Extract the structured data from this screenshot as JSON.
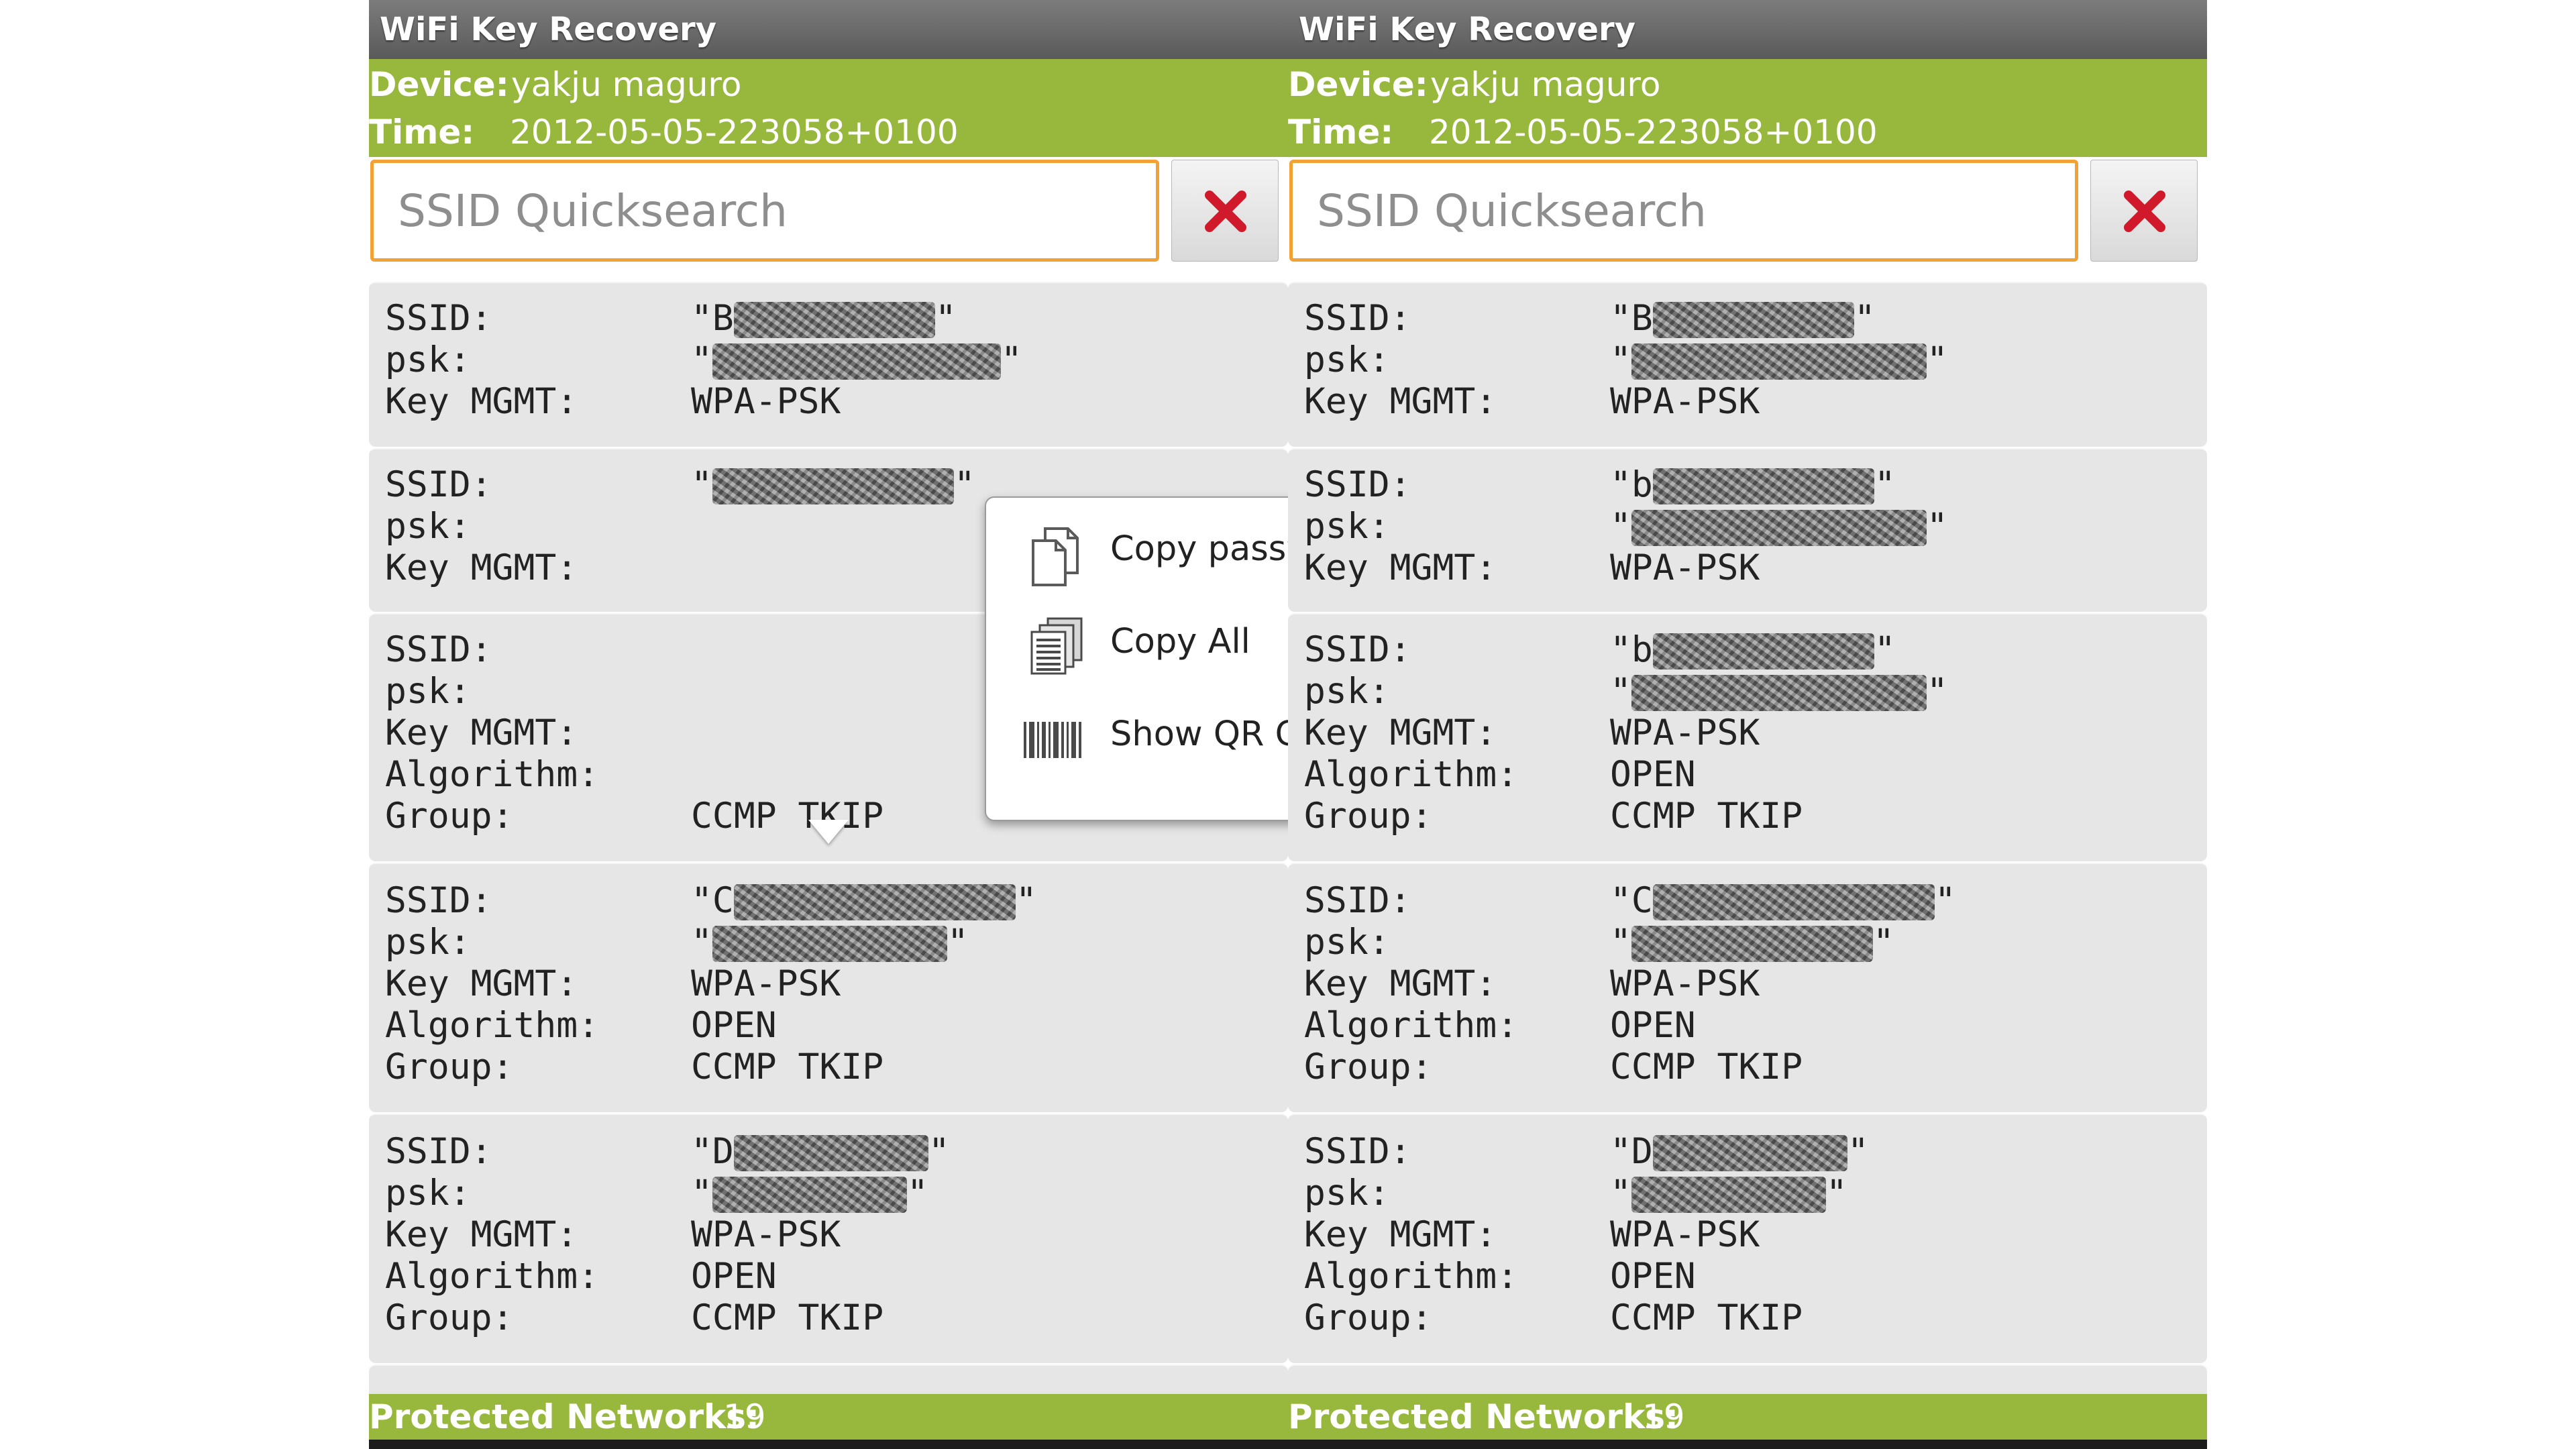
{
  "app": {
    "title": "WiFi Key Recovery"
  },
  "device": {
    "label": "Device:",
    "value": "yakju maguro"
  },
  "time": {
    "label": "Time:",
    "value": "2012-05-05-223058+0100"
  },
  "search": {
    "placeholder": "SSID Quicksearch",
    "clear_icon": "close-x-icon",
    "clear_color": "#d01a2b"
  },
  "labels": {
    "ssid": "SSID:",
    "psk": "psk:",
    "key_mgmt": "Key MGMT:",
    "algorithm": "Algorithm:",
    "group": "Group:",
    "quote": "\""
  },
  "left_networks": [
    {
      "ssid_prefix": "\"B",
      "key_mgmt": "WPA-PSK"
    },
    {
      "ssid_prefix": "\"",
      "key_mgmt": ""
    },
    {
      "ssid_prefix": "",
      "key_mgmt": "",
      "group": "CCMP TKIP"
    },
    {
      "ssid_prefix": "\"C",
      "key_mgmt": "WPA-PSK",
      "algorithm": "OPEN",
      "group": "CCMP TKIP"
    },
    {
      "ssid_prefix": "\"D",
      "key_mgmt": "WPA-PSK",
      "algorithm": "OPEN",
      "group": "CCMP TKIP"
    }
  ],
  "right_networks": [
    {
      "ssid_prefix": "\"B",
      "key_mgmt": "WPA-PSK"
    },
    {
      "ssid_prefix": "\"b",
      "key_mgmt": "WPA-PSK"
    },
    {
      "ssid_prefix": "\"b",
      "key_mgmt": "WPA-PSK",
      "algorithm": "OPEN",
      "group": "CCMP TKIP"
    },
    {
      "ssid_prefix": "\"C",
      "key_mgmt": "WPA-PSK",
      "algorithm": "OPEN",
      "group": "CCMP TKIP"
    },
    {
      "ssid_prefix": "\"D",
      "key_mgmt": "WPA-PSK",
      "algorithm": "OPEN",
      "group": "CCMP TKIP"
    }
  ],
  "context_menu": {
    "items": [
      {
        "label": "Copy password",
        "icon": "copy-icon"
      },
      {
        "label": "Copy All",
        "icon": "copy-all-icon"
      },
      {
        "label": "Show QR Code",
        "icon": "barcode-icon"
      }
    ]
  },
  "footer": {
    "label": "Protected Networks:",
    "count": "19"
  },
  "colors": {
    "green": "#97b83c",
    "orange_border": "#f2a234",
    "title_gray": "#6a6a6a",
    "entry_bg": "#e6e6e6"
  }
}
